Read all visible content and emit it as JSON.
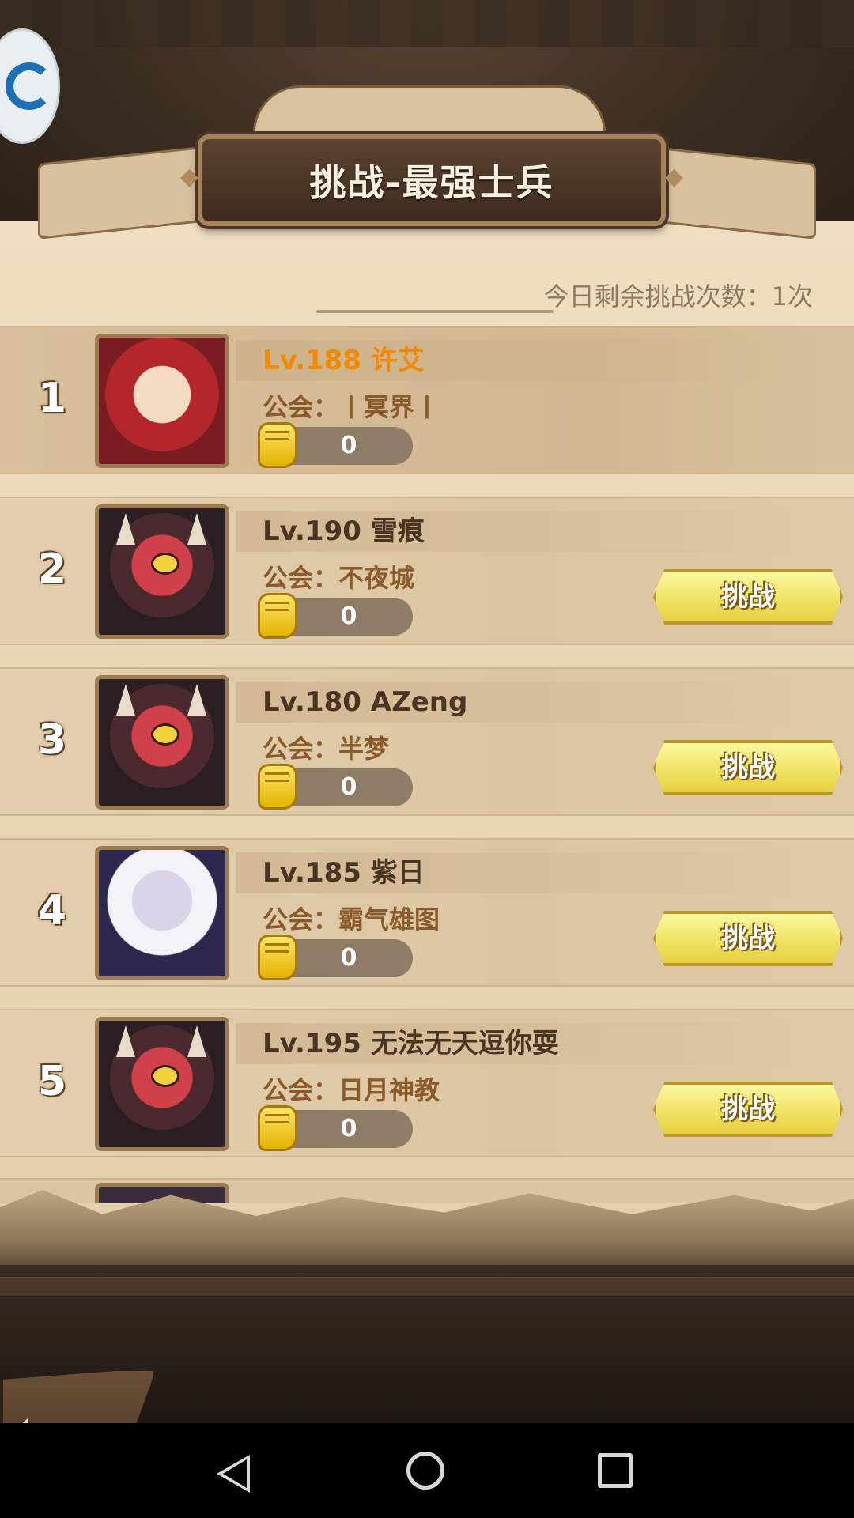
{
  "header": {
    "title": "挑战-最强士兵",
    "remaining_label": "今日剩余挑战次数：1次"
  },
  "guild_prefix": "公会：",
  "challenge_label": "挑战",
  "rows": [
    {
      "rank": "1",
      "name": "Lv.188 许艾",
      "guild": "丨冥界丨",
      "power": "0",
      "avatar": "girl-avatar",
      "is_self": true
    },
    {
      "rank": "2",
      "name": "Lv.190 雪痕",
      "guild": "不夜城",
      "power": "0",
      "avatar": "demon-avatar",
      "is_self": false
    },
    {
      "rank": "3",
      "name": "Lv.180 AZeng",
      "guild": "半梦",
      "power": "0",
      "avatar": "demon-avatar",
      "is_self": false
    },
    {
      "rank": "4",
      "name": "Lv.185 紫日",
      "guild": "霸气雄图",
      "power": "0",
      "avatar": "pale-knight-avatar",
      "is_self": false
    },
    {
      "rank": "5",
      "name": "Lv.195 无法无天逗你耍",
      "guild": "日月神教",
      "power": "0",
      "avatar": "demon-avatar",
      "is_self": false
    }
  ],
  "colors": {
    "self_name": "#f08a00",
    "button_yellow": "#f2e56a",
    "parchment": "#e9d7b5"
  },
  "icons": {
    "power": "fist-icon",
    "back": "back-arrow-icon"
  }
}
